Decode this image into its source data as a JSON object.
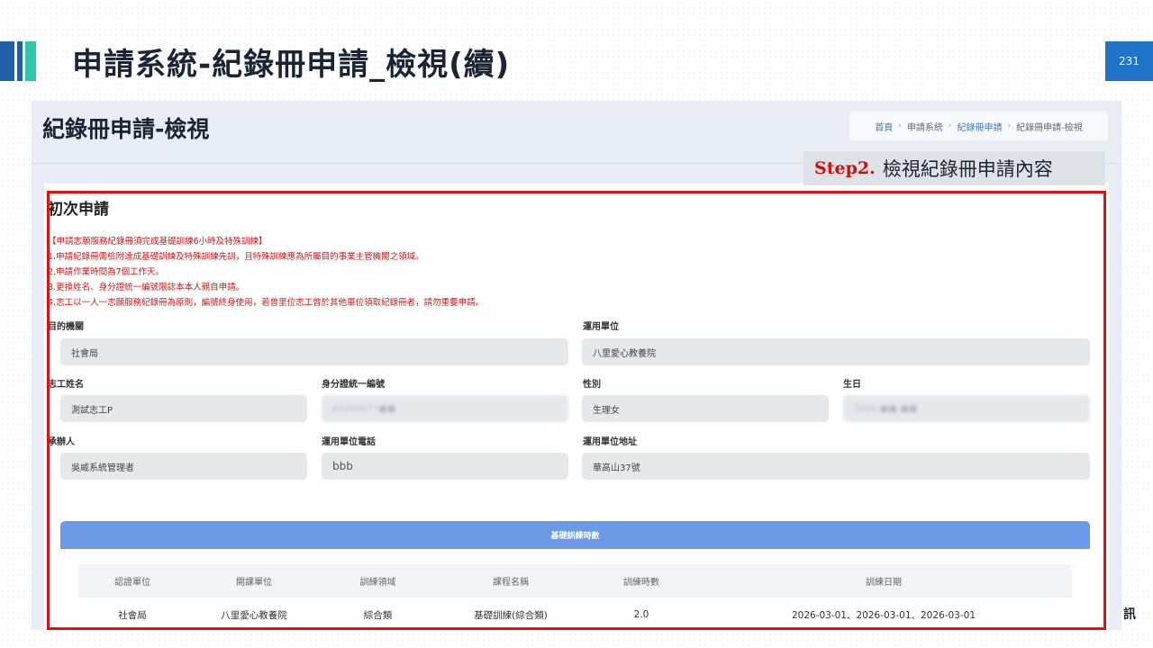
{
  "slide": {
    "title": "申請系統-紀錄冊申請_檢視(續)",
    "page_number": "231",
    "logo_char": "訊",
    "colors": {
      "accent_blue": "#1f74c9",
      "accent_teal": "#2fc7a8",
      "highlight_red": "#e01010"
    }
  },
  "app": {
    "page_title": "紀錄冊申請-檢視",
    "breadcrumb": [
      "首頁",
      "申請系統",
      "紀錄冊申請",
      "紀錄冊申請-檢視"
    ],
    "step": {
      "number": "Step2.",
      "text": "檢視紀錄冊申請內容"
    },
    "card_heading": "初次申請",
    "notice": [
      "【申請志願服務紀錄冊須完成基礎訓練6小時及特殊訓練】",
      "1.申請紀錄冊需檢附達成基礎訓練及特殊訓練先訓，且特殊訓練應為所屬目的事業主管機關之領域。",
      "2.申請作業時間為7個工作天。",
      "3.更換姓名、身分證統一編號限誌本本人親自申請。",
      "4.志工以一人一志願服務紀錄冊為原則，編號終身使用，若曾里位志工曾於其他單位領取紀錄冊者，請勿重要申請。"
    ],
    "fields": {
      "target_agency": {
        "label": "目的機關",
        "value": "社會局"
      },
      "employer": {
        "label": "運用單位",
        "value": "八里愛心教養院"
      },
      "volunteer_name": {
        "label": "志工姓名",
        "value": "測試志工P"
      },
      "id_number": {
        "label": "身分證統一編號",
        "value": "A2000077■■"
      },
      "gender": {
        "label": "性別",
        "value": "生理女"
      },
      "birthday": {
        "label": "生日",
        "value": "2000-■■-■■"
      },
      "handler": {
        "label": "承辦人",
        "value": "吳威系統管理者"
      },
      "employer_phone": {
        "label": "運用單位電話",
        "value": "bbb"
      },
      "employer_address": {
        "label": "運用單位地址",
        "value": "華高山37號"
      }
    },
    "training_section": {
      "title": "基礎訓練時數"
    },
    "training_table": {
      "headers": [
        "認證單位",
        "開課單位",
        "訓練領域",
        "課程名稱",
        "訓練時數",
        "訓練日期"
      ],
      "rows": [
        [
          "社會局",
          "八里愛心教養院",
          "綜合類",
          "基礎訓練(綜合類)",
          "2.0",
          "2026-03-01、2026-03-01、2026-03-01"
        ]
      ]
    }
  }
}
